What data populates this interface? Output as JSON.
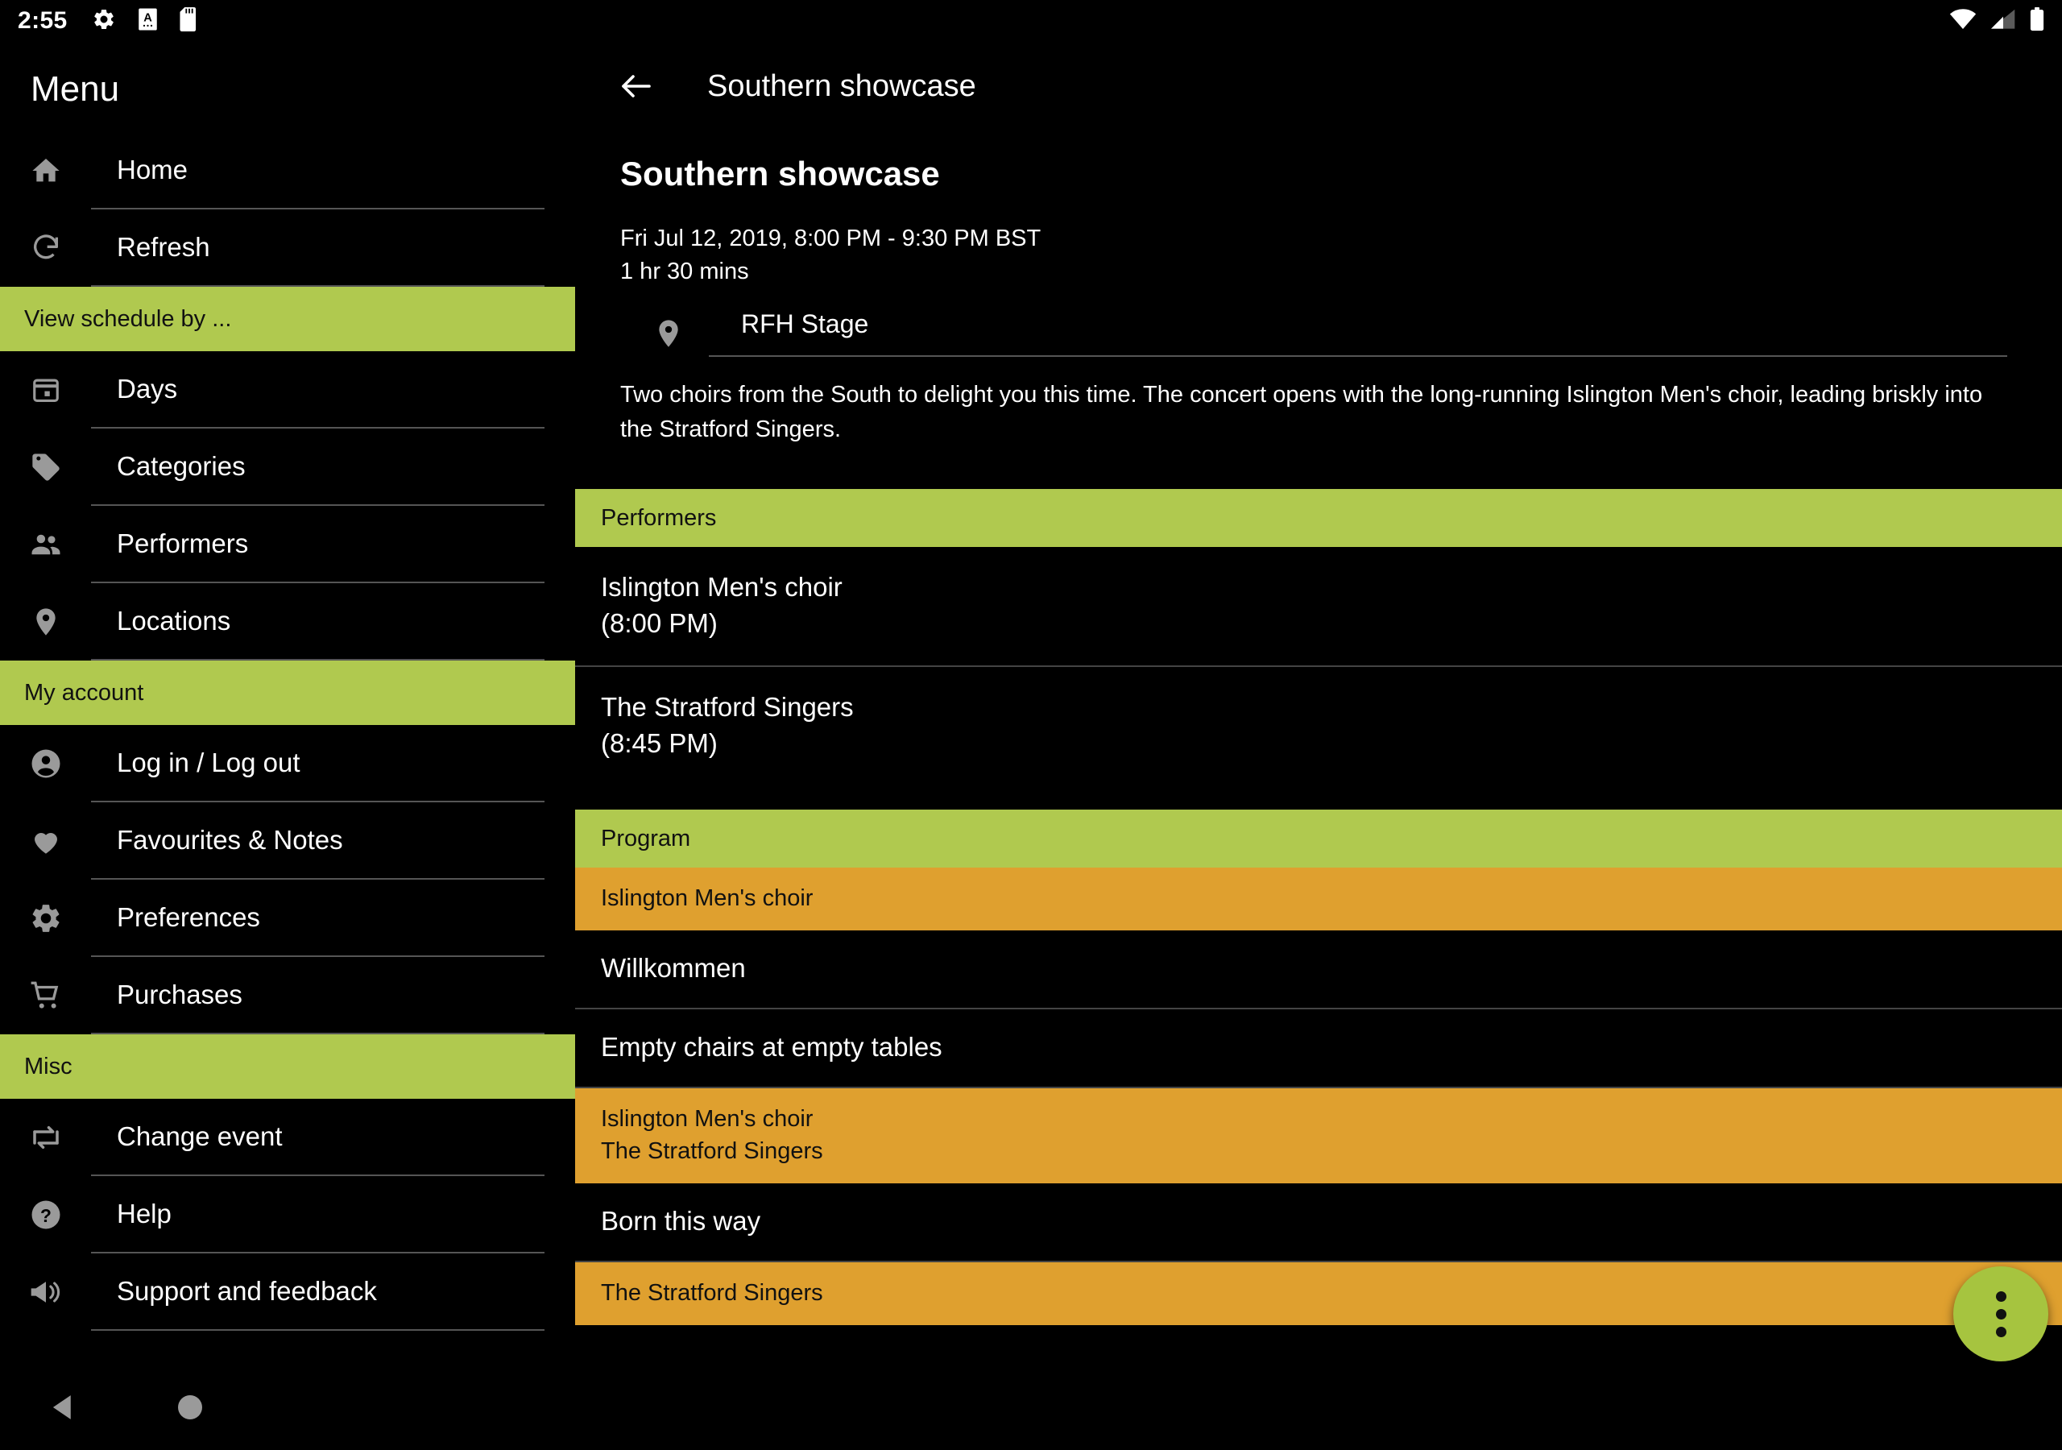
{
  "status_bar": {
    "time": "2:55",
    "left_icons": [
      "gear-icon",
      "document-a-icon",
      "sd-card-icon"
    ],
    "right_icons": [
      "wifi-icon",
      "signal-icon",
      "battery-icon"
    ]
  },
  "sidebar": {
    "title": "Menu",
    "groups": [
      {
        "header": null,
        "items": [
          {
            "label": "Home",
            "icon": "home-icon"
          },
          {
            "label": "Refresh",
            "icon": "refresh-icon"
          }
        ]
      },
      {
        "header": "View schedule by ...",
        "items": [
          {
            "label": "Days",
            "icon": "calendar-icon"
          },
          {
            "label": "Categories",
            "icon": "tag-icon"
          },
          {
            "label": "Performers",
            "icon": "people-icon"
          },
          {
            "label": "Locations",
            "icon": "location-pin-icon"
          }
        ]
      },
      {
        "header": "My account",
        "items": [
          {
            "label": "Log in / Log out",
            "icon": "account-circle-icon"
          },
          {
            "label": "Favourites & Notes",
            "icon": "heart-icon"
          },
          {
            "label": "Preferences",
            "icon": "gear-icon"
          },
          {
            "label": "Purchases",
            "icon": "shopping-cart-icon"
          }
        ]
      },
      {
        "header": "Misc",
        "items": [
          {
            "label": "Change event",
            "icon": "swap-icon"
          },
          {
            "label": "Help",
            "icon": "help-circle-icon"
          },
          {
            "label": "Support and feedback",
            "icon": "megaphone-icon"
          }
        ]
      }
    ]
  },
  "appbar": {
    "back_icon": "arrow-left-icon",
    "title": "Southern showcase"
  },
  "event": {
    "title": "Southern showcase",
    "datetime": "Fri Jul 12, 2019, 8:00 PM - 9:30 PM BST",
    "duration": "1 hr 30 mins",
    "location_icon": "location-pin-icon",
    "location": "RFH Stage",
    "description": "Two choirs from the South to delight you this time. The concert opens with the long-running Islington Men's choir, leading briskly into the Stratford Singers."
  },
  "performers_section": {
    "header": "Performers",
    "items": [
      {
        "name": "Islington Men's choir",
        "time": "(8:00 PM)"
      },
      {
        "name": "The Stratford Singers",
        "time": "(8:45 PM)"
      }
    ]
  },
  "program_section": {
    "header": "Program",
    "rows": [
      {
        "type": "performer",
        "line1": "Islington Men's choir",
        "line2": ""
      },
      {
        "type": "piece",
        "line1": "Willkommen"
      },
      {
        "type": "piece",
        "line1": "Empty chairs at empty tables"
      },
      {
        "type": "performer",
        "line1": "Islington Men's choir",
        "line2": "The Stratford Singers"
      },
      {
        "type": "piece",
        "line1": "Born this way"
      },
      {
        "type": "performer",
        "line1": "The Stratford Singers",
        "line2": ""
      }
    ]
  },
  "fab": {
    "icon": "more-vert-icon"
  },
  "nav_bar": {
    "back_icon": "nav-back-triangle-icon",
    "home_icon": "nav-home-circle-icon"
  },
  "colors": {
    "accent_green": "#b0c94f",
    "fab_green": "#a6c43f",
    "row_orange": "#dfa02f",
    "background": "#000000",
    "icon_grey": "#9a9a9a"
  }
}
